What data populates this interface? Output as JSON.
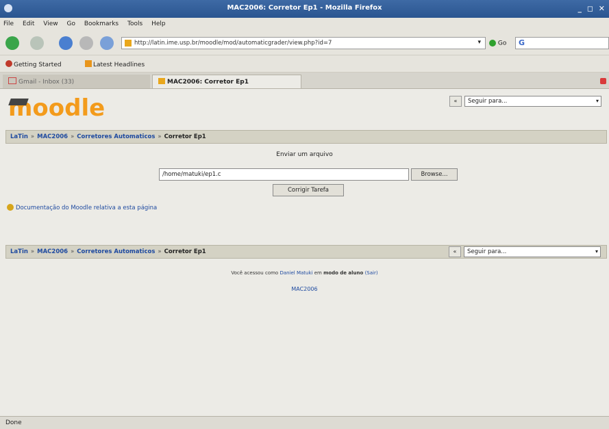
{
  "window": {
    "title": "MAC2006: Corretor Ep1 - Mozilla Firefox",
    "controls": "_ ◻ ✕"
  },
  "menu": {
    "items": [
      "File",
      "Edit",
      "View",
      "Go",
      "Bookmarks",
      "Tools",
      "Help"
    ]
  },
  "nav": {
    "url": "http://latin.ime.usp.br/moodle/mod/automaticgrader/view.php?id=7",
    "go_label": "Go"
  },
  "bookmarks": {
    "items": [
      "Getting Started",
      "Latest Headlines"
    ]
  },
  "tabs": [
    {
      "label": "Gmail - Inbox (33)"
    },
    {
      "label": "MAC2006: Corretor Ep1"
    }
  ],
  "page": {
    "logo": "moodle",
    "jump": {
      "placeholder": "Seguir para...",
      "arrow": "«"
    },
    "breadcrumb": [
      {
        "label": "LaTin"
      },
      {
        "label": "MAC2006"
      },
      {
        "label": "Corretores Automaticos"
      },
      {
        "label": "Corretor Ep1"
      }
    ],
    "breadcrumb_sep": "»",
    "upload": {
      "title": "Enviar um arquivo",
      "file_value": "/home/matuki/ep1.c",
      "browse_label": "Browse...",
      "submit_label": "Corrigir Tarefa"
    },
    "doc_link": "Documentação do Moodle relativa a esta página",
    "footer": {
      "prefix": "Você acessou como ",
      "user": "Daniel Matuki",
      "middle": " em ",
      "mode": "modo",
      "suffix_plain": " ",
      "role": "de aluno",
      "logout": "(Sair)",
      "course": "MAC2006"
    }
  },
  "status": {
    "text": "Done"
  }
}
